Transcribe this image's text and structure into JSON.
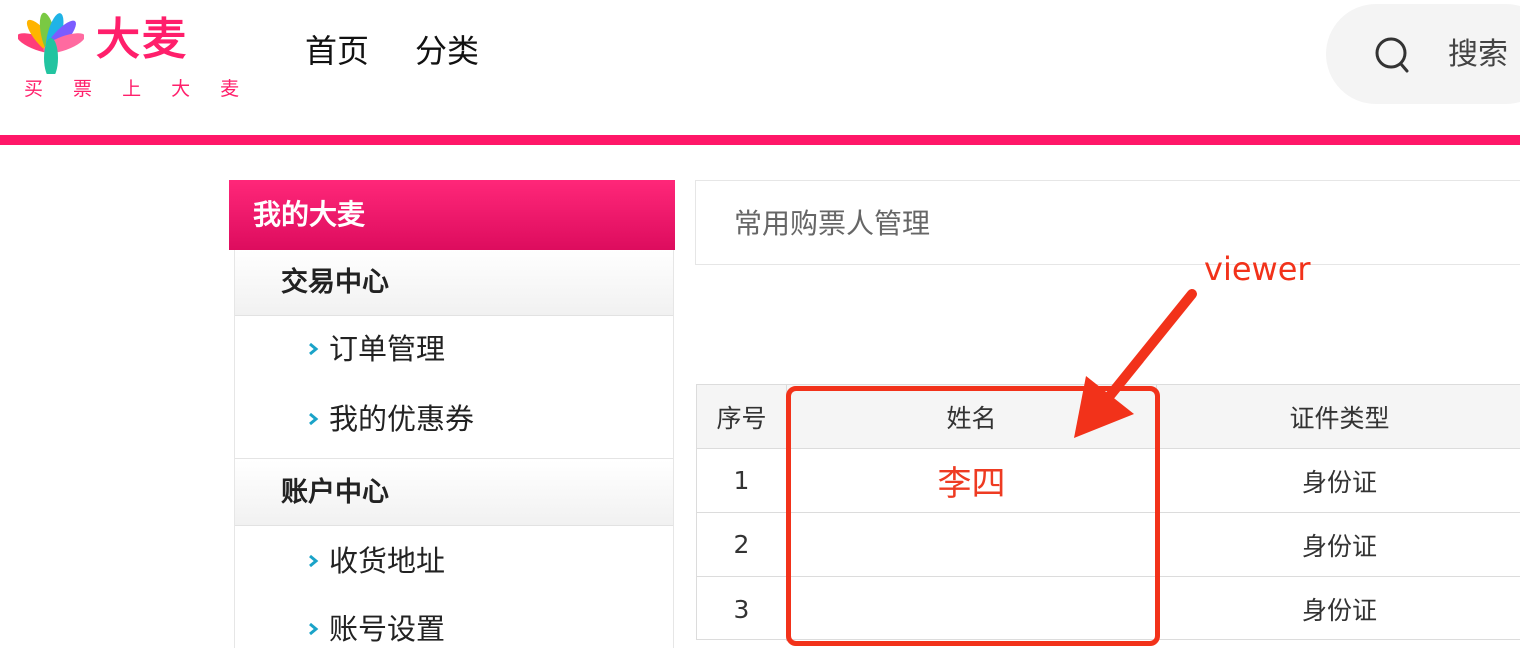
{
  "brand": {
    "logo_text": "大麦",
    "slogan": "买 票 上 大 麦",
    "color": "#ff1f6b"
  },
  "nav": {
    "items": [
      "首页",
      "分类"
    ]
  },
  "search": {
    "icon": "search-icon",
    "placeholder": "搜索"
  },
  "sidebar": {
    "header": "我的大麦",
    "sections": [
      {
        "title": "交易中心",
        "links": [
          "订单管理",
          "我的优惠券"
        ]
      },
      {
        "title": "账户中心",
        "links": [
          "收货地址",
          "账号设置"
        ]
      }
    ]
  },
  "main": {
    "panel_title": "常用购票人管理",
    "table": {
      "columns": [
        "序号",
        "姓名",
        "证件类型"
      ],
      "rows": [
        {
          "seq": "1",
          "name": "李四",
          "type": "身份证"
        },
        {
          "seq": "2",
          "name": "",
          "type": "身份证"
        },
        {
          "seq": "3",
          "name": "",
          "type": "身份证"
        }
      ]
    }
  },
  "annotation": {
    "label": "viewer",
    "color": "#f2321a"
  }
}
